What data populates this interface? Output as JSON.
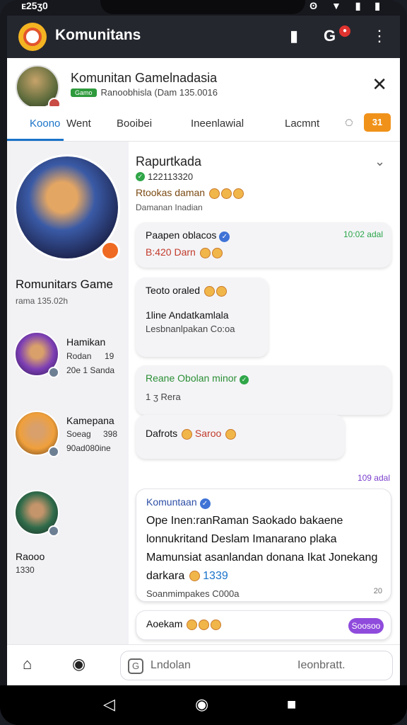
{
  "status": {
    "time": "ᴇ25ʒ0",
    "icons": "ʘ ▼ ▮ ▮"
  },
  "appbar": {
    "title": "Komunitans",
    "badge": "●"
  },
  "header": {
    "name": "Komunitan Gamelnadasia",
    "pill": "Gamo",
    "sub": "Ranoobhisla (Dam 135.0016"
  },
  "tabs": [
    "Koono",
    "Went",
    "Booibei",
    "Ineenlawial",
    "Lacmnt"
  ],
  "tab_button": "31",
  "sidebar": {
    "title": "Romunitars Game",
    "sub": "rama 135.02h",
    "contacts": [
      {
        "name": "Hamikan",
        "line": "Rodan",
        "num": "19",
        "meta": "20e 1 Sanda"
      },
      {
        "name": "Kamepana",
        "line": "Soeag",
        "num": "398",
        "meta": "90ad080ine"
      },
      {
        "name": "Raooo",
        "line": "",
        "num": "",
        "meta": "1330"
      }
    ]
  },
  "chat": {
    "name": "Rapurtkada",
    "line1": "122113320",
    "line2": "Rtookas daman",
    "line3": "Damanan Inadian",
    "messages": [
      {
        "title": "Paapen oblacos",
        "line": "B:420 Darn",
        "time": "10:02 adal"
      },
      {
        "title": "Teoto oraled",
        "line": "1line Andatkamlala",
        "small": "Lesbnanlpakan Co:oa"
      },
      {
        "title": "Reane Obolan minor",
        "small": "1 ʒ Rera"
      },
      {
        "title": "Dafrots",
        "extra": "Saroo"
      },
      {
        "title": "Komuntaan",
        "time": "109 adal",
        "text": "Ope Inen:ranRaman Saokado bakaene lonnukritand Deslam Imanarano plaka Mamunsiat asanlandan donana Ikat Jonekang darkara",
        "num": "1339",
        "small": "Soanmimpakes C000a",
        "small_time": "20"
      },
      {
        "title": "Aoekam",
        "button": "Soosoo"
      }
    ]
  },
  "bottom": {
    "placeholder": "Lndolan",
    "placeholder2": "Ieonbratt."
  }
}
